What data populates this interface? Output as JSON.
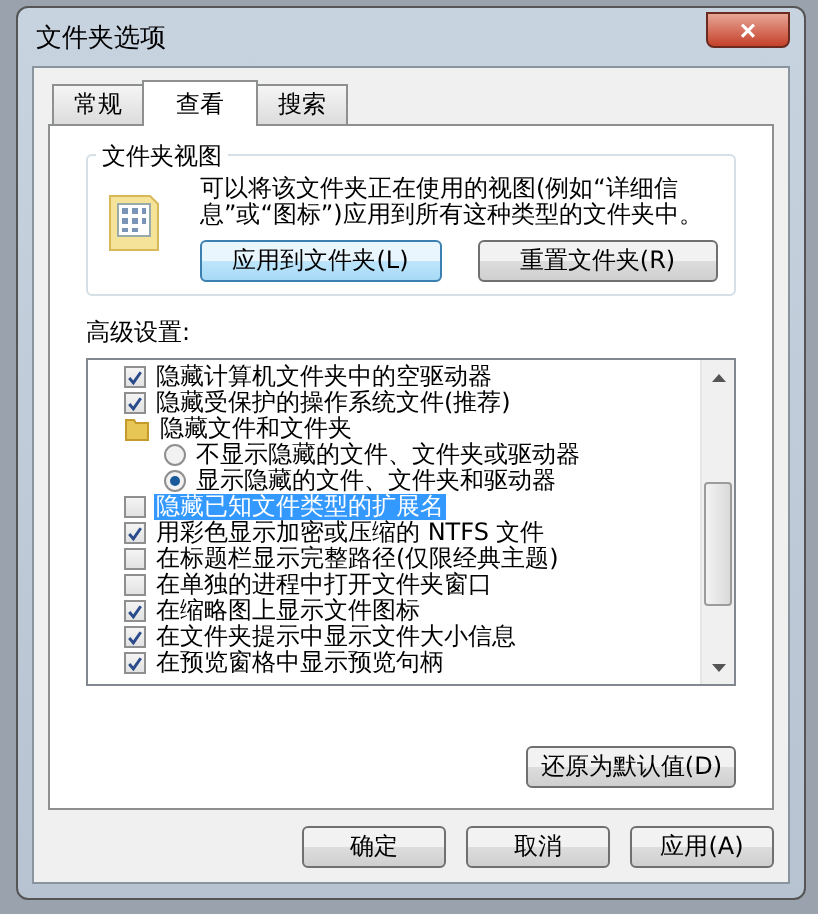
{
  "window": {
    "title": "文件夹选项",
    "close": "×"
  },
  "tabs": [
    {
      "label": "常规",
      "selected": false
    },
    {
      "label": "查看",
      "selected": true
    },
    {
      "label": "搜索",
      "selected": false
    }
  ],
  "folder_views": {
    "title": "文件夹视图",
    "description": "可以将该文件夹正在使用的视图(例如“详细信息”或“图标”)应用到所有这种类型的文件夹中。",
    "buttons": [
      "应用到文件夹(L)",
      "重置文件夹(R)"
    ]
  },
  "advanced": {
    "label": "高级设置:",
    "items": [
      {
        "kind": "checkbox",
        "label": "隐藏计算机文件夹中的空驱动器",
        "checked": true,
        "selected": false
      },
      {
        "kind": "checkbox",
        "label": "隐藏受保护的操作系统文件(推荐)",
        "checked": true,
        "selected": false
      },
      {
        "kind": "folder",
        "label": "隐藏文件和文件夹",
        "selected": false,
        "children": [
          {
            "kind": "radio",
            "label": "不显示隐藏的文件、文件夹或驱动器",
            "checked": false,
            "selected": false
          },
          {
            "kind": "radio",
            "label": "显示隐藏的文件、文件夹和驱动器",
            "checked": true,
            "selected": false
          }
        ]
      },
      {
        "kind": "checkbox",
        "label": "隐藏已知文件类型的扩展名",
        "checked": false,
        "selected": true
      },
      {
        "kind": "checkbox",
        "label": "用彩色显示加密或压缩的 NTFS 文件",
        "checked": true,
        "selected": false
      },
      {
        "kind": "checkbox",
        "label": "在标题栏显示完整路径(仅限经典主题)",
        "checked": false,
        "selected": false
      },
      {
        "kind": "checkbox",
        "label": "在单独的进程中打开文件夹窗口",
        "checked": false,
        "selected": false
      },
      {
        "kind": "checkbox",
        "label": "在缩略图上显示文件图标",
        "checked": true,
        "selected": false
      },
      {
        "kind": "checkbox",
        "label": "在文件夹提示中显示文件大小信息",
        "checked": true,
        "selected": false
      },
      {
        "kind": "checkbox",
        "label": "在预览窗格中显示预览句柄",
        "checked": true,
        "selected": false
      }
    ],
    "restore_button": "还原为默认值(D)"
  },
  "buttons": [
    "确定",
    "取消",
    "应用(A)"
  ]
}
